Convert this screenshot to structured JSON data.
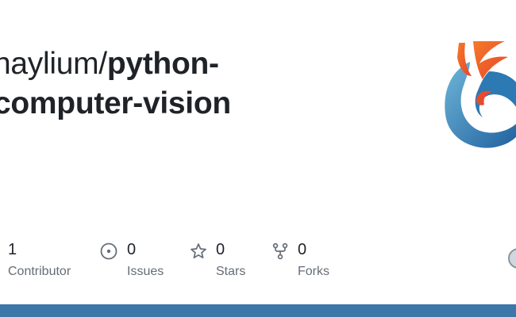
{
  "repo": {
    "owner": "naylium/",
    "name_line1": "python-",
    "name_line2": "computer-vision"
  },
  "stats": {
    "contributors": {
      "count": "1",
      "label": "Contributor"
    },
    "issues": {
      "count": "0",
      "label": "Issues"
    },
    "stars": {
      "count": "0",
      "label": "Stars"
    },
    "forks": {
      "count": "0",
      "label": "Forks"
    }
  },
  "colors": {
    "bottom_bar": "#3d76a8",
    "text": "#1f2328",
    "muted": "#656d76"
  },
  "icons": {
    "logo": "phoenix-logo",
    "issues": "issue-opened-icon",
    "stars": "star-icon",
    "forks": "repo-forked-icon",
    "avatar": "avatar"
  }
}
